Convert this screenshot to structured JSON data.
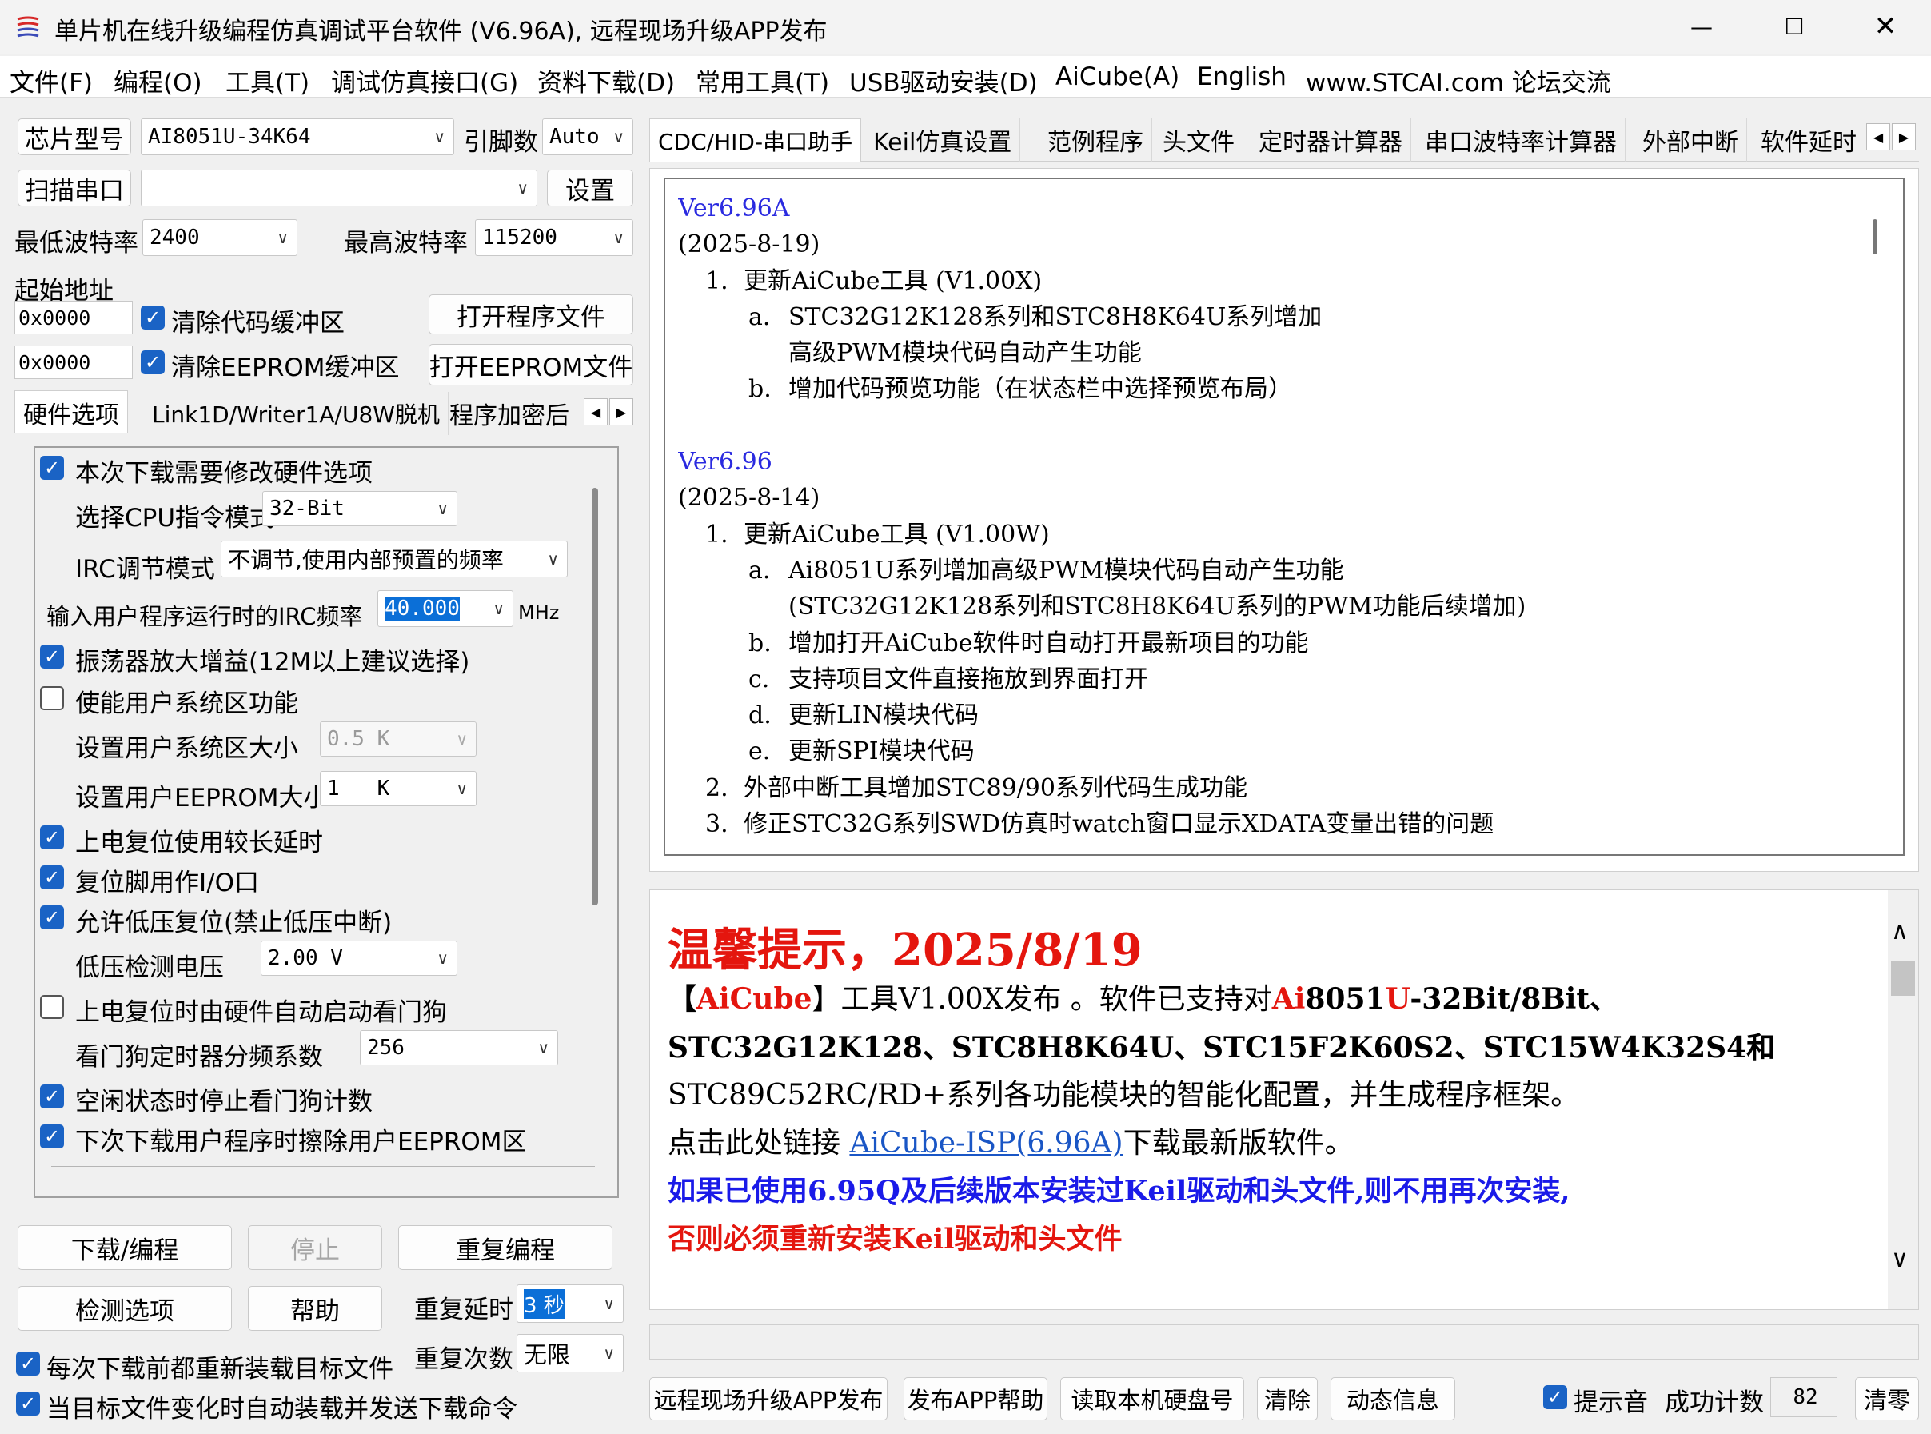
{
  "window": {
    "title": "单片机在线升级编程仿真调试平台软件 (V6.96A), 远程现场升级APP发布",
    "minimize_icon": "minimize-icon",
    "maximize_icon": "maximize-icon",
    "close_icon": "close-icon"
  },
  "menu": [
    "文件(F)",
    "编程(O)",
    "工具(T)",
    "调试仿真接口(G)",
    "资料下载(D)",
    "常用工具(T)",
    "USB驱动安装(D)",
    "AiCube(A)",
    "English",
    "www.STCAI.com 论坛交流"
  ],
  "left": {
    "chip_type_btn": "芯片型号",
    "chip_model": "AI8051U-34K64",
    "pin_label": "引脚数",
    "pin_value": "Auto",
    "scan_port_btn": "扫描串口",
    "port_value": "",
    "settings_btn": "设置",
    "min_baud_label": "最低波特率",
    "min_baud": "2400",
    "max_baud_label": "最高波特率",
    "max_baud": "115200",
    "start_addr_label": "起始地址",
    "addr1": "0x0000",
    "clear_code_label": "清除代码缓冲区",
    "open_prog_btn": "打开程序文件",
    "addr2": "0x0000",
    "clear_eeprom_label": "清除EEPROM缓冲区",
    "open_eeprom_btn": "打开EEPROM文件",
    "tabs": [
      "硬件选项",
      "Link1D/Writer1A/U8W脱机",
      "程序加密后"
    ],
    "hw": {
      "modify_hw": "本次下载需要修改硬件选项",
      "cpu_mode_label": "选择CPU指令模式",
      "cpu_mode": "32-Bit",
      "irc_mode_label": "IRC调节模式",
      "irc_mode": "不调节,使用内部预置的频率",
      "irc_freq_label": "输入用户程序运行时的IRC频率",
      "irc_freq": "40.000",
      "irc_unit": "MHz",
      "osc_gain": "振荡器放大增益(12M以上建议选择)",
      "sys_area": "使能用户系统区功能",
      "sys_area_size_label": "设置用户系统区大小",
      "sys_area_size": "0.5 K",
      "eeprom_size_label": "设置用户EEPROM大小",
      "eeprom_size": "1   K",
      "long_delay": "上电复位使用较长延时",
      "reset_io": "复位脚用作I/O口",
      "low_volt_reset": "允许低压复位(禁止低压中断)",
      "low_volt_label": "低压检测电压",
      "low_volt": "2.00 V",
      "wdt_auto": "上电复位时由硬件自动启动看门狗",
      "wdt_div_label": "看门狗定时器分频系数",
      "wdt_div": "256",
      "idle_stop_wdt": "空闲状态时停止看门狗计数",
      "erase_eeprom": "下次下载用户程序时擦除用户EEPROM区"
    },
    "download_btn": "下载/编程",
    "stop_btn": "停止",
    "repeat_btn": "重复编程",
    "check_btn": "检测选项",
    "help_btn": "帮助",
    "repeat_delay_label": "重复延时",
    "repeat_delay": "3 秒",
    "repeat_count_label": "重复次数",
    "repeat_count": "无限",
    "reload_label": "每次下载前都重新装载目标文件",
    "autoload_label": "当目标文件变化时自动装载并发送下载命令"
  },
  "right": {
    "tabs": [
      "CDC/HID-串口助手",
      "Keil仿真设置",
      "范例程序",
      "头文件",
      "定时器计算器",
      "串口波特率计算器",
      "外部中断",
      "软件延时"
    ],
    "changelog": [
      {
        "kind": "ver",
        "text": "Ver6.96A"
      },
      {
        "kind": "date",
        "text": "(2025-8-19)"
      },
      {
        "kind": "l1",
        "num": "1.",
        "text": "更新AiCube工具 (V1.00X)"
      },
      {
        "kind": "l2",
        "num": "a.",
        "text": "STC32G12K128系列和STC8H8K64U系列增加"
      },
      {
        "kind": "l2c",
        "num": "",
        "text": "高级PWM模块代码自动产生功能"
      },
      {
        "kind": "l2",
        "num": "b.",
        "text": "增加代码预览功能（在状态栏中选择预览布局）"
      },
      {
        "kind": "gap",
        "text": ""
      },
      {
        "kind": "ver",
        "text": "Ver6.96"
      },
      {
        "kind": "date",
        "text": "(2025-8-14)"
      },
      {
        "kind": "l1",
        "num": "1.",
        "text": "更新AiCube工具 (V1.00W)"
      },
      {
        "kind": "l2",
        "num": "a.",
        "text": "Ai8051U系列增加高级PWM模块代码自动产生功能"
      },
      {
        "kind": "l2c",
        "num": "",
        "text": "(STC32G12K128系列和STC8H8K64U系列的PWM功能后续增加)"
      },
      {
        "kind": "l2",
        "num": "b.",
        "text": "增加打开AiCube软件时自动打开最新项目的功能"
      },
      {
        "kind": "l2",
        "num": "c.",
        "text": "支持项目文件直接拖放到界面打开"
      },
      {
        "kind": "l2",
        "num": "d.",
        "text": "更新LIN模块代码"
      },
      {
        "kind": "l2",
        "num": "e.",
        "text": "更新SPI模块代码"
      },
      {
        "kind": "l1",
        "num": "2.",
        "text": "外部中断工具增加STC89/90系列代码生成功能"
      },
      {
        "kind": "l1",
        "num": "3.",
        "text": "修正STC32G系列SWD仿真时watch窗口显示XDATA变量出错的问题"
      }
    ],
    "notice": {
      "title": "温馨提示，2025/8/19",
      "l1_a": "【",
      "l1_b": "AiCube",
      "l1_c": "】工具V1.00X发布 。软件已支持对",
      "l1_d": "Ai",
      "l1_e": "8051",
      "l1_f": "U",
      "l1_g": "-32Bit/8Bit、",
      "l2": "STC32G12K128、STC8H8K64U、STC15F2K60S2、STC15W4K32S4和",
      "l3": "STC89C52RC/RD+系列各功能模块的智能化配置，并生成程序框架。",
      "l4_a": "点击此处链接 ",
      "l4_link": "AiCube-ISP(6.96A)",
      "l4_b": "下载最新版软件。",
      "l5": "如果已使用6.95Q及后续版本安装过Keil驱动和头文件,则不用再次安装,",
      "l6": "否则必须重新安装Keil驱动和头文件"
    },
    "status_text": "",
    "bottom_btns": [
      "远程现场升级APP发布",
      "发布APP帮助",
      "读取本机硬盘号",
      "清除",
      "动态信息"
    ],
    "sound_label": "提示音",
    "success_label": "成功计数",
    "success_count": "82",
    "reset_btn": "清零"
  },
  "colors": {
    "accent": "#1a63c5",
    "highlight": "#e4160e",
    "link": "#1a56c5",
    "version": "#2a2ae0"
  }
}
